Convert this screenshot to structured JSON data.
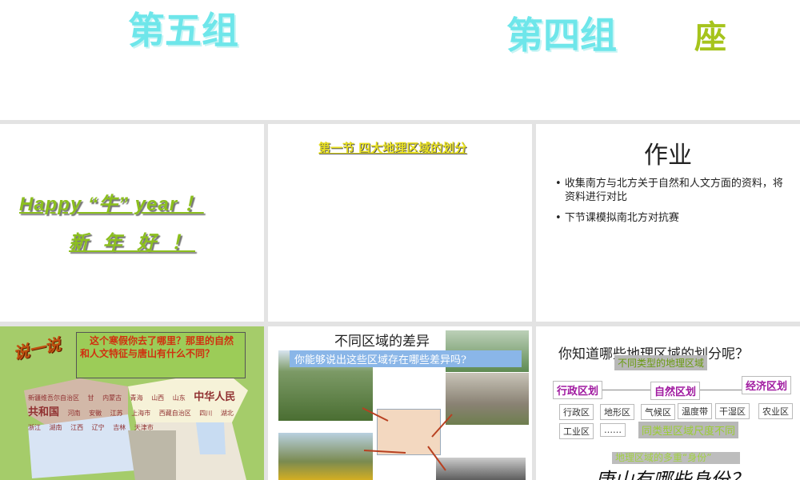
{
  "top_row": {
    "group5": "第五组",
    "group4": "第四组",
    "seat": "座"
  },
  "slide1": {
    "line1": "Happy “牛” year ！",
    "line2": "新 年 好 ！"
  },
  "slide2": {
    "title": "第一节 四大地理区域的划分"
  },
  "slide3": {
    "title": "作业",
    "bullets": [
      "收集南方与北方关于自然和人文方面的资料，将资料进行对比",
      "下节课模拟南北方对抗赛"
    ]
  },
  "slide4": {
    "badge": "说一说",
    "question": "这个寒假你去了哪里？那里的自然和人文特征与唐山有什么不同？",
    "map_labels": [
      "新疆维吾尔自治区",
      "甘",
      "内蒙古",
      "青海",
      "西藏自治区",
      "中华人民共和国",
      "四川",
      "山西",
      "山东",
      "河南",
      "安徽",
      "江苏",
      "上海市",
      "浙江",
      "湖北",
      "湖南",
      "江西",
      "辽宁",
      "吉林",
      "天津市"
    ]
  },
  "slide5": {
    "title": "不同区域的差异",
    "question": "你能够说出这些区域存在哪些差异吗?"
  },
  "slide6": {
    "title": "你知道哪些地理区域的划分呢？",
    "type_box": "不同类型的地理区域",
    "categories": [
      "行政区划",
      "自然区划",
      "经济区划"
    ],
    "items": [
      "行政区",
      "地形区",
      "气候区",
      "温度带",
      "干湿区",
      "农业区",
      "工业区",
      "……"
    ],
    "scale_box": "同类型区域尺度不同",
    "identity_box": "地理区域的多重“身份”",
    "bottom_question": "唐山有哪些身份？"
  }
}
